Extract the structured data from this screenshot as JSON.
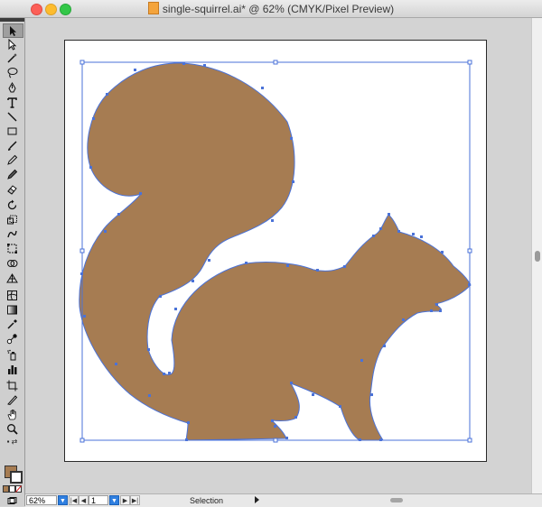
{
  "window": {
    "title": "single-squirrel.ai* @ 62% (CMYK/Pixel Preview)"
  },
  "statusbar": {
    "zoom": "62%",
    "page": "1",
    "tool_label": "Selection"
  },
  "tools": [
    {
      "name": "selection-tool",
      "icon": "arrow-icon",
      "selected": true
    },
    {
      "name": "direct-selection-tool",
      "icon": "white-arrow-icon"
    },
    {
      "name": "magic-wand-tool",
      "icon": "wand-icon"
    },
    {
      "name": "lasso-tool",
      "icon": "lasso-icon"
    },
    {
      "name": "pen-tool",
      "icon": "pen-icon"
    },
    {
      "name": "type-tool",
      "icon": "type-icon"
    },
    {
      "name": "line-tool",
      "icon": "line-icon"
    },
    {
      "name": "rectangle-tool",
      "icon": "rectangle-icon"
    },
    {
      "name": "paintbrush-tool",
      "icon": "brush-icon"
    },
    {
      "name": "pencil-tool",
      "icon": "pencil-icon"
    },
    {
      "name": "blob-brush-tool",
      "icon": "blob-brush-icon"
    },
    {
      "name": "eraser-tool",
      "icon": "eraser-icon"
    },
    {
      "name": "rotate-tool",
      "icon": "rotate-icon"
    },
    {
      "name": "scale-tool",
      "icon": "scale-icon"
    },
    {
      "name": "puppet-warp-tool",
      "icon": "warp-icon"
    },
    {
      "name": "free-transform-tool",
      "icon": "transform-icon"
    },
    {
      "name": "shape-builder-tool",
      "icon": "shape-builder-icon"
    },
    {
      "name": "perspective-grid-tool",
      "icon": "perspective-icon"
    },
    {
      "name": "mesh-tool",
      "icon": "mesh-icon"
    },
    {
      "name": "gradient-tool",
      "icon": "gradient-icon"
    },
    {
      "name": "eyedropper-tool",
      "icon": "eyedropper-icon"
    },
    {
      "name": "blend-tool",
      "icon": "blend-icon"
    },
    {
      "name": "symbol-sprayer-tool",
      "icon": "sprayer-icon"
    },
    {
      "name": "column-graph-tool",
      "icon": "graph-icon"
    },
    {
      "name": "artboard-tool",
      "icon": "artboard-icon"
    },
    {
      "name": "slice-tool",
      "icon": "slice-icon"
    },
    {
      "name": "hand-tool",
      "icon": "hand-icon"
    },
    {
      "name": "zoom-tool",
      "icon": "zoom-icon"
    }
  ],
  "colors": {
    "fill": "#a67c52",
    "selection": "#4a72d8",
    "artboard": "#ffffff",
    "canvas": "#d3d3d3"
  }
}
